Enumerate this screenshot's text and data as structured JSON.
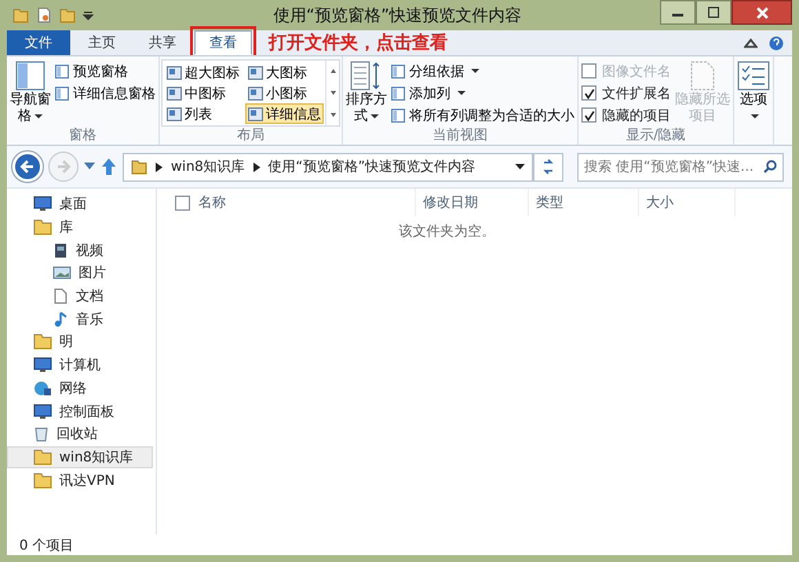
{
  "window": {
    "title": "使用“预览窗格”快速预览文件内容"
  },
  "tabs": [
    {
      "label": "文件",
      "kind": "file",
      "selected": false,
      "highlighted": false
    },
    {
      "label": "主页",
      "kind": "tab",
      "selected": false,
      "highlighted": false
    },
    {
      "label": "共享",
      "kind": "tab",
      "selected": false,
      "highlighted": false
    },
    {
      "label": "查看",
      "kind": "tab",
      "selected": true,
      "highlighted": true
    }
  ],
  "annotation": {
    "text": "打开文件夹，点击查看"
  },
  "ribbon_groups": [
    {
      "title": "窗格",
      "items": [
        {
          "kind": "big",
          "label": "导航窗格",
          "dropdown": true,
          "disabled": false
        },
        {
          "kind": "stack",
          "items": [
            {
              "label": "预览窗格",
              "dropdown": false
            },
            {
              "label": "详细信息窗格",
              "dropdown": false
            }
          ]
        }
      ]
    },
    {
      "title": "布局",
      "items": [
        {
          "kind": "gallery",
          "items": [
            {
              "label": "超大图标",
              "selected": false
            },
            {
              "label": "大图标",
              "selected": false
            },
            {
              "label": "中图标",
              "selected": false
            },
            {
              "label": "小图标",
              "selected": false
            },
            {
              "label": "列表",
              "selected": false
            },
            {
              "label": "详细信息",
              "selected": true
            }
          ]
        }
      ]
    },
    {
      "title": "当前视图",
      "items": [
        {
          "kind": "big",
          "label": "排序方式",
          "dropdown": true,
          "disabled": false
        },
        {
          "kind": "stack",
          "items": [
            {
              "label": "分组依据",
              "dropdown": true
            },
            {
              "label": "添加列",
              "dropdown": true
            },
            {
              "label": "将所有列调整为合适的大小",
              "dropdown": false
            }
          ]
        }
      ]
    },
    {
      "title": "显示/隐藏",
      "items": [
        {
          "kind": "checks",
          "items": [
            {
              "label": "图像文件名",
              "checked": false,
              "disabled": true
            },
            {
              "label": "文件扩展名",
              "checked": true,
              "disabled": false
            },
            {
              "label": "隐藏的项目",
              "checked": true,
              "disabled": false
            }
          ]
        },
        {
          "kind": "big",
          "label": "隐藏所选项目",
          "dropdown": false,
          "disabled": true
        }
      ]
    },
    {
      "items": [
        {
          "kind": "big",
          "label": "选项",
          "dropdown": true,
          "disabled": false
        }
      ]
    }
  ],
  "address": {
    "crumbs": [
      "win8知识库",
      "使用“预览窗格”快速预览文件内容"
    ]
  },
  "search": {
    "placeholder": "搜索 使用“预览窗格”快速..."
  },
  "nav": [
    {
      "label": "桌面",
      "kind": "desktop",
      "selected": false
    },
    {
      "label": "库",
      "kind": "library",
      "selected": false,
      "children": [
        {
          "label": "视频",
          "kind": "video",
          "selected": false
        },
        {
          "label": "图片",
          "kind": "picture",
          "selected": false
        },
        {
          "label": "文档",
          "kind": "document",
          "selected": false
        },
        {
          "label": "音乐",
          "kind": "music",
          "selected": false
        }
      ]
    },
    {
      "label": "明",
      "kind": "user",
      "selected": false
    },
    {
      "label": "计算机",
      "kind": "computer",
      "selected": false
    },
    {
      "label": "网络",
      "kind": "network",
      "selected": false
    },
    {
      "label": "控制面板",
      "kind": "control",
      "selected": false
    },
    {
      "label": "回收站",
      "kind": "recycle",
      "selected": false
    },
    {
      "label": "win8知识库",
      "kind": "folder",
      "selected": true
    },
    {
      "label": "讯达VPN",
      "kind": "folder",
      "selected": false
    }
  ],
  "columns": [
    "名称",
    "修改日期",
    "类型",
    "大小"
  ],
  "select_all_checked": false,
  "empty_message": "该文件夹为空。",
  "status_bar": {
    "count": "0 个项目"
  }
}
